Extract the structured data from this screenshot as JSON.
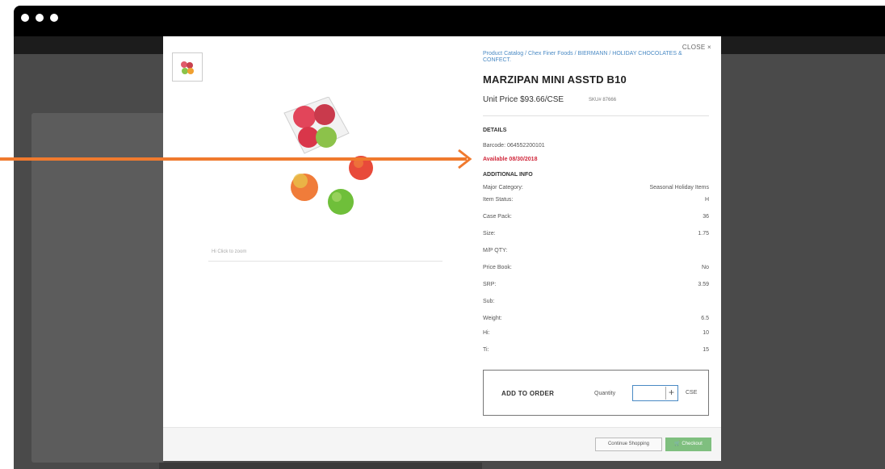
{
  "modal": {
    "close_label": "CLOSE ×",
    "image_caption": "Hi Click to zoom",
    "breadcrumb": "Product Catalog / Chex Finer Foods / BIERMANN / HOLIDAY CHOCOLATES & CONFECT.",
    "title": "MARZIPAN MINI ASSTD B10",
    "unit_price": "Unit Price  $93.66/CSE",
    "sku": "SKU# 87666",
    "details_heading": "DETAILS",
    "barcode": "Barcode:  064552200101",
    "availability": "Available 08/30/2018",
    "additional_heading": "ADDITIONAL INFO",
    "info": [
      {
        "label": "Major Category:",
        "value": "Seasonal Holiday Items"
      },
      {
        "label": "Item Status:",
        "value": "H"
      },
      {
        "label": "Case Pack:",
        "value": "36"
      },
      {
        "label": "Size:",
        "value": "1.75"
      },
      {
        "label": "M/P QTY:",
        "value": ""
      },
      {
        "label": "Price Book:",
        "value": "No"
      },
      {
        "label": "SRP:",
        "value": "3.59"
      },
      {
        "label": "Sub:",
        "value": ""
      },
      {
        "label": "Weight:",
        "value": "6.5"
      },
      {
        "label": "Hi:",
        "value": "10"
      },
      {
        "label": "Ti:",
        "value": "15"
      }
    ],
    "order": {
      "label": "ADD TO ORDER",
      "quantity_label": "Quantity",
      "quantity_value": "",
      "plus": "+",
      "unit": "CSE"
    },
    "footer": {
      "continue_label": "Continue Shopping",
      "checkout_label": "Checkout"
    }
  },
  "colors": {
    "accent_link": "#4a8ac4",
    "availability": "#d0263a",
    "checkout": "#7fbf7f",
    "annotation_arrow": "#f07a2e"
  }
}
